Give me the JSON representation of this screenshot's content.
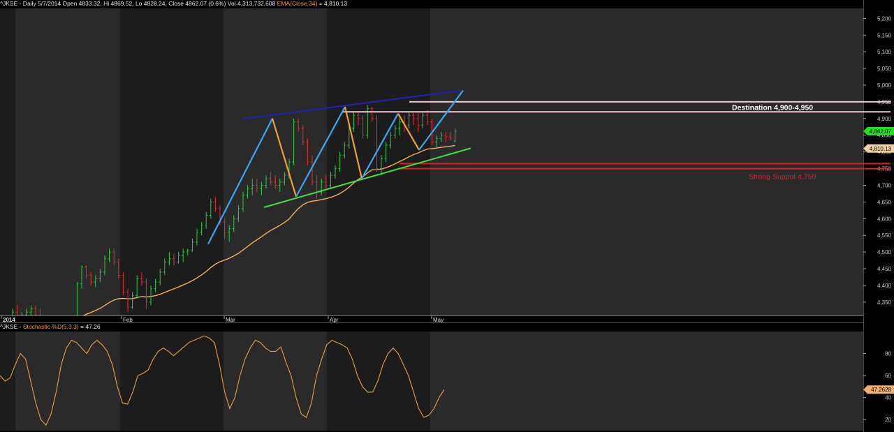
{
  "header": {
    "symbol_info": "^JKSE - Daily 5/7/2014 Open 4833.32, Hi 4869.52, Lo 4828.24, Close 4862.07 (0.6%) Vol 4,313,732,608",
    "ema_label": "EMA(Close,34)",
    "ema_value": " = 4,810.13"
  },
  "lower_header": {
    "symbol": "^JKSE - ",
    "indicator": "Stochastic %D(5,3,3)",
    "value": " = 47.26"
  },
  "colors": {
    "background": "#000000",
    "panel_band_dark": "#1c1c1c",
    "panel_band_light": "#2a2a2a",
    "up_bar": "#2ecc40",
    "down_bar": "#e03030",
    "ema": "#f5b060",
    "stochastic": "#e8a050",
    "trend_blue": "#3aa8f0",
    "trend_orange": "#f0a030",
    "channel_top": "#2020c0",
    "channel_bottom": "#40e040",
    "resistance": "#f0c8d8",
    "support": "#e02020",
    "last_price_bg": "#20e020"
  },
  "annotations": {
    "destination": "Destination   4,900-4,950",
    "support": "Strong Suppot 4,750"
  },
  "price_tags": {
    "last": "4,862.07",
    "ema": "4,810.13",
    "stoch": "47.2628"
  },
  "chart_data": [
    {
      "type": "candlestick",
      "title": "^JKSE Daily",
      "x_tick_labels": [
        "2014",
        "Feb",
        "Mar",
        "Apr",
        "May"
      ],
      "y_tick_labels": [
        "4,350",
        "4,400",
        "4,450",
        "4,500",
        "4,550",
        "4,600",
        "4,650",
        "4,700",
        "4,750",
        "4,800",
        "4,850",
        "4,900",
        "4,950",
        "5,000",
        "5,050",
        "5,100",
        "5,150",
        "5,200"
      ],
      "ylim": [
        4310,
        5230
      ],
      "ohlc": [
        [
          4300,
          4330,
          4280,
          4320
        ],
        [
          4320,
          4340,
          4300,
          4300
        ],
        [
          4300,
          4320,
          4290,
          4310
        ],
        [
          4310,
          4330,
          4295,
          4320
        ],
        [
          4320,
          4340,
          4310,
          4330
        ],
        [
          4330,
          4340,
          4300,
          4310
        ],
        [
          4310,
          4330,
          4290,
          4300
        ],
        [
          4300,
          4310,
          4270,
          4290
        ],
        [
          4290,
          4300,
          4260,
          4280
        ],
        [
          4280,
          4290,
          4250,
          4270
        ],
        [
          4270,
          4280,
          4255,
          4260
        ],
        [
          4260,
          4280,
          4240,
          4275
        ],
        [
          4275,
          4300,
          4260,
          4290
        ],
        [
          4290,
          4300,
          4270,
          4280
        ],
        [
          4285,
          4410,
          4280,
          4405
        ],
        [
          4405,
          4460,
          4390,
          4455
        ],
        [
          4455,
          4460,
          4420,
          4430
        ],
        [
          4430,
          4440,
          4400,
          4410
        ],
        [
          4410,
          4430,
          4395,
          4420
        ],
        [
          4420,
          4450,
          4410,
          4440
        ],
        [
          4440,
          4490,
          4430,
          4480
        ],
        [
          4480,
          4510,
          4470,
          4500
        ],
        [
          4500,
          4510,
          4460,
          4470
        ],
        [
          4470,
          4480,
          4420,
          4430
        ],
        [
          4430,
          4440,
          4370,
          4380
        ],
        [
          4380,
          4390,
          4320,
          4335
        ],
        [
          4335,
          4380,
          4330,
          4370
        ],
        [
          4370,
          4430,
          4360,
          4420
        ],
        [
          4420,
          4440,
          4400,
          4410
        ],
        [
          4410,
          4420,
          4330,
          4350
        ],
        [
          4350,
          4400,
          4340,
          4390
        ],
        [
          4390,
          4420,
          4380,
          4410
        ],
        [
          4410,
          4450,
          4400,
          4440
        ],
        [
          4440,
          4480,
          4430,
          4470
        ],
        [
          4470,
          4500,
          4460,
          4480
        ],
        [
          4480,
          4495,
          4460,
          4470
        ],
        [
          4470,
          4500,
          4465,
          4490
        ],
        [
          4490,
          4510,
          4470,
          4500
        ],
        [
          4500,
          4510,
          4490,
          4505
        ],
        [
          4505,
          4540,
          4500,
          4530
        ],
        [
          4530,
          4570,
          4520,
          4560
        ],
        [
          4560,
          4590,
          4550,
          4580
        ],
        [
          4580,
          4620,
          4570,
          4610
        ],
        [
          4610,
          4660,
          4600,
          4650
        ],
        [
          4650,
          4665,
          4620,
          4630
        ],
        [
          4630,
          4640,
          4580,
          4590
        ],
        [
          4590,
          4600,
          4540,
          4560
        ],
        [
          4560,
          4580,
          4530,
          4570
        ],
        [
          4570,
          4610,
          4560,
          4600
        ],
        [
          4600,
          4640,
          4590,
          4630
        ],
        [
          4630,
          4680,
          4620,
          4670
        ],
        [
          4670,
          4700,
          4660,
          4690
        ],
        [
          4690,
          4720,
          4670,
          4700
        ],
        [
          4700,
          4720,
          4680,
          4690
        ],
        [
          4690,
          4710,
          4670,
          4700
        ],
        [
          4700,
          4730,
          4690,
          4720
        ],
        [
          4720,
          4740,
          4700,
          4710
        ],
        [
          4710,
          4730,
          4690,
          4700
        ],
        [
          4700,
          4720,
          4680,
          4710
        ],
        [
          4710,
          4740,
          4700,
          4730
        ],
        [
          4730,
          4780,
          4720,
          4770
        ],
        [
          4770,
          4900,
          4760,
          4890
        ],
        [
          4890,
          4900,
          4860,
          4870
        ],
        [
          4870,
          4880,
          4820,
          4830
        ],
        [
          4830,
          4840,
          4760,
          4770
        ],
        [
          4770,
          4790,
          4700,
          4710
        ],
        [
          4710,
          4730,
          4660,
          4680
        ],
        [
          4680,
          4720,
          4670,
          4710
        ],
        [
          4710,
          4730,
          4690,
          4700
        ],
        [
          4700,
          4740,
          4690,
          4730
        ],
        [
          4730,
          4760,
          4720,
          4750
        ],
        [
          4750,
          4800,
          4740,
          4790
        ],
        [
          4790,
          4830,
          4780,
          4820
        ],
        [
          4820,
          4880,
          4810,
          4870
        ],
        [
          4870,
          4920,
          4860,
          4910
        ],
        [
          4910,
          4920,
          4880,
          4900
        ],
        [
          4900,
          4910,
          4840,
          4850
        ],
        [
          4850,
          4940,
          4840,
          4930
        ],
        [
          4930,
          4935,
          4890,
          4900
        ],
        [
          4900,
          4910,
          4740,
          4750
        ],
        [
          4750,
          4790,
          4730,
          4780
        ],
        [
          4780,
          4830,
          4770,
          4820
        ],
        [
          4820,
          4860,
          4810,
          4850
        ],
        [
          4850,
          4880,
          4840,
          4870
        ],
        [
          4870,
          4900,
          4850,
          4890
        ],
        [
          4890,
          4910,
          4860,
          4880
        ],
        [
          4880,
          4920,
          4870,
          4910
        ],
        [
          4910,
          4920,
          4880,
          4900
        ],
        [
          4900,
          4920,
          4860,
          4880
        ],
        [
          4880,
          4920,
          4870,
          4910
        ],
        [
          4910,
          4925,
          4880,
          4890
        ],
        [
          4890,
          4900,
          4820,
          4830
        ],
        [
          4830,
          4850,
          4810,
          4840
        ],
        [
          4840,
          4860,
          4830,
          4850
        ],
        [
          4850,
          4860,
          4830,
          4845
        ],
        [
          4845,
          4860,
          4835,
          4840
        ],
        [
          4833,
          4870,
          4828,
          4862
        ]
      ],
      "ema_value_last": 4810.13,
      "last_close": 4862.07,
      "levels": {
        "resistance": [
          4950,
          4920
        ],
        "support": [
          4765,
          4750
        ]
      }
    },
    {
      "type": "line",
      "title": "Stochastic %D(5,3,3)",
      "y_tick_labels": [
        "20",
        "40",
        "60",
        "80"
      ],
      "ylim": [
        10,
        100
      ],
      "values": [
        60,
        55,
        58,
        70,
        80,
        75,
        55,
        35,
        20,
        15,
        25,
        45,
        70,
        85,
        92,
        90,
        85,
        80,
        88,
        92,
        88,
        82,
        70,
        50,
        35,
        34,
        45,
        60,
        62,
        65,
        75,
        82,
        85,
        82,
        78,
        82,
        86,
        90,
        92,
        94,
        96,
        94,
        90,
        70,
        45,
        30,
        40,
        60,
        75,
        85,
        92,
        90,
        85,
        82,
        82,
        86,
        72,
        60,
        40,
        25,
        22,
        35,
        60,
        75,
        88,
        92,
        90,
        88,
        85,
        75,
        60,
        50,
        45,
        45,
        55,
        70,
        80,
        85,
        80,
        70,
        60,
        45,
        30,
        22,
        24,
        30,
        40,
        47.26
      ]
    }
  ]
}
